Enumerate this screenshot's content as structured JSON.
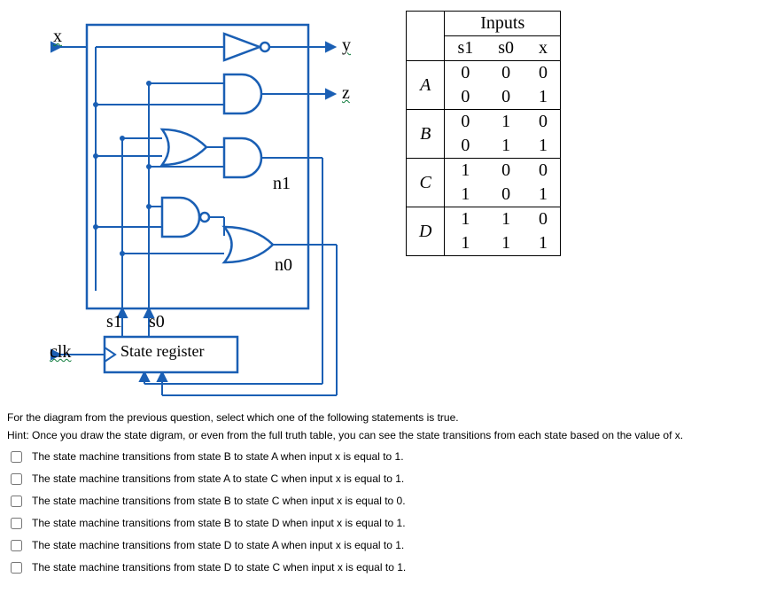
{
  "circuit": {
    "input_x": "x",
    "input_clk": "clk",
    "output_y": "y",
    "output_z": "z",
    "signal_n1": "n1",
    "signal_n0": "n0",
    "signal_s1": "s1",
    "signal_s0": "s0",
    "state_register": "State register"
  },
  "table": {
    "header": "Inputs",
    "col_s1": "s1",
    "col_s0": "s0",
    "col_x": "x",
    "rows": [
      {
        "state": "A",
        "s1": "0",
        "s0": "0",
        "x": "0"
      },
      {
        "state": "",
        "s1": "0",
        "s0": "0",
        "x": "1"
      },
      {
        "state": "B",
        "s1": "0",
        "s0": "1",
        "x": "0"
      },
      {
        "state": "",
        "s1": "0",
        "s0": "1",
        "x": "1"
      },
      {
        "state": "C",
        "s1": "1",
        "s0": "0",
        "x": "0"
      },
      {
        "state": "",
        "s1": "1",
        "s0": "0",
        "x": "1"
      },
      {
        "state": "D",
        "s1": "1",
        "s0": "1",
        "x": "0"
      },
      {
        "state": "",
        "s1": "1",
        "s0": "1",
        "x": "1"
      }
    ]
  },
  "question": "For the diagram from the previous question, select which one of the following statements is true.",
  "hint": "Hint: Once you draw the state digram, or even from the full truth table, you can see the state transitions from each state based on the value of x.",
  "options": [
    "The state machine transitions from state B to state A when input x is equal to 1.",
    "The state machine transitions from state A to state C when input  x is equal to 1.",
    "The state machine transitions from state B to state C when input x is equal to 0.",
    "The state machine transitions from state B to state D when input x is equal to 1.",
    "The state machine transitions from state D to state A when input x is equal to 1.",
    "The state machine transitions from state D to state C when input x is equal to 1."
  ]
}
